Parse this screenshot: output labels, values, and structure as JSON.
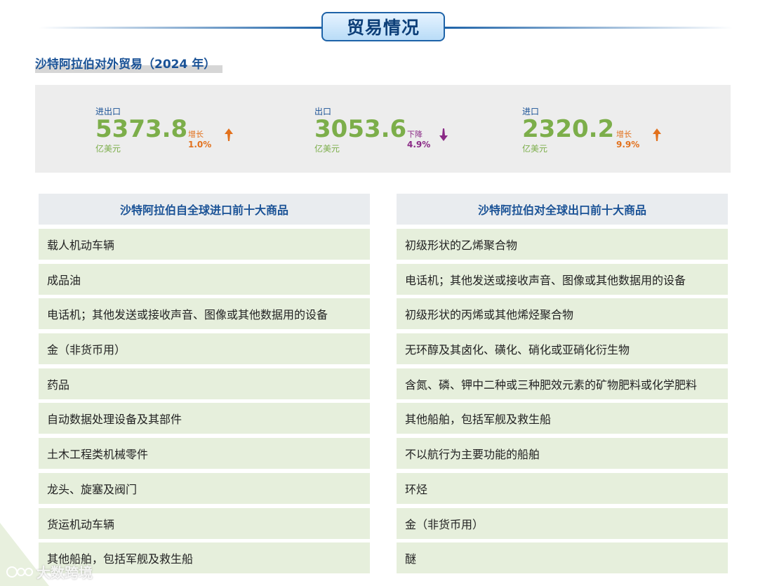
{
  "header": {
    "title": "贸易情况"
  },
  "section": {
    "title": "沙特阿拉伯对外贸易（2024 年）"
  },
  "stats": [
    {
      "label": "进出口",
      "value": "5373.8",
      "unit": "亿美元",
      "change_label": "增长",
      "change_value": "1.0%",
      "direction": "up"
    },
    {
      "label": "出口",
      "value": "3053.6",
      "unit": "亿美元",
      "change_label": "下降",
      "change_value": "4.9%",
      "direction": "down"
    },
    {
      "label": "进口",
      "value": "2320.2",
      "unit": "亿美元",
      "change_label": "增长",
      "change_value": "9.9%",
      "direction": "up"
    }
  ],
  "imports": {
    "title": "沙特阿拉伯自全球进口前十大商品",
    "items": [
      "载人机动车辆",
      "成品油",
      "电话机；其他发送或接收声音、图像或其他数据用的设备",
      "金（非货币用）",
      "药品",
      "自动数据处理设备及其部件",
      "土木工程类机械零件",
      "龙头、旋塞及阀门",
      "货运机动车辆",
      "其他船舶，包括军舰及救生船"
    ]
  },
  "exports": {
    "title": "沙特阿拉伯对全球出口前十大商品",
    "items": [
      "初级形状的乙烯聚合物",
      "电话机；其他发送或接收声音、图像或其他数据用的设备",
      "初级形状的丙烯或其他烯烃聚合物",
      "无环醇及其卤化、磺化、硝化或亚硝化衍生物",
      "含氮、磷、钾中二种或三种肥效元素的矿物肥料或化学肥料",
      "其他船舶，包括军舰及救生船",
      "不以航行为主要功能的船舶",
      "环烃",
      "金（非货币用）",
      "醚"
    ]
  },
  "watermark": {
    "text": "大数跨境"
  },
  "colors": {
    "accent_blue": "#1a5296",
    "value_green": "#7cae4a",
    "up_orange": "#e2711d",
    "down_purple": "#8a2a86",
    "row_green": "#e6efdc"
  }
}
